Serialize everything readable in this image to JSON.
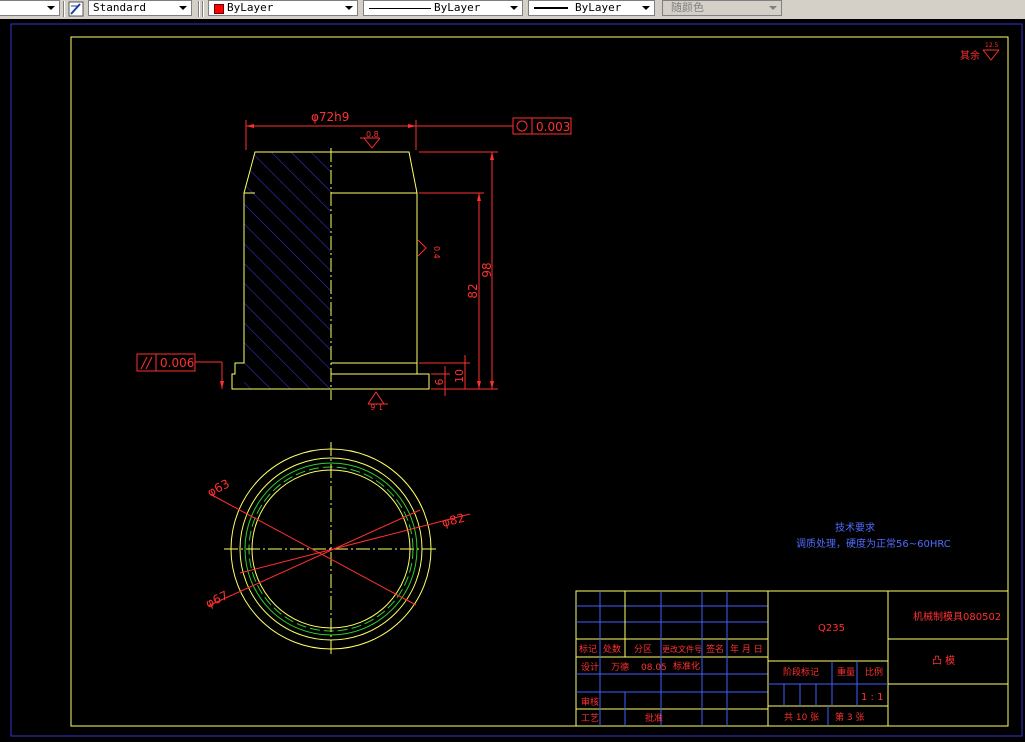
{
  "toolbar": {
    "text_style": "Standard",
    "layer_color": "ByLayer",
    "linetype": "ByLayer",
    "lineweight": "ByLayer",
    "plot_style": "随颜色",
    "layer_color_swatch": "#ff0000"
  },
  "drawing": {
    "roughness_other": "其余",
    "roughness_other_value": "12.5",
    "dim_diameter": "φ72h9",
    "roundness_tol": "0.003",
    "roughness_top": "0.8",
    "roughness_side": "0.4",
    "dim_height_98": "98",
    "dim_height_82": "82",
    "parallel_tol": "0.006",
    "dim_10": "10",
    "dim_6": "6",
    "roughness_bottom": "1.6",
    "dim_phi63": "φ63",
    "dim_phi82": "φ82",
    "dim_phi67": "φ67",
    "tech_req_title": "技术要求",
    "tech_req_text": "调质处理，硬度为正常56~60HRC"
  },
  "title_block": {
    "material": "Q235",
    "drawing_no": "机械制模具080502",
    "part_name": "凸 模",
    "col_mark": "标记",
    "col_qty": "处数",
    "col_zone": "分区",
    "col_doc": "更改文件号",
    "col_sign": "签名",
    "col_date": "年 月 日",
    "design": "设计",
    "designer": "万德",
    "design_date": "08.05",
    "standardize": "标准化",
    "stage_mark": "阶段标记",
    "weight": "重量",
    "scale": "比例",
    "scale_value": "1 : 1",
    "review": "审核",
    "process": "工艺",
    "approve": "批准",
    "total_sheets": "共 10 张",
    "sheet_no": "第 3 张"
  }
}
